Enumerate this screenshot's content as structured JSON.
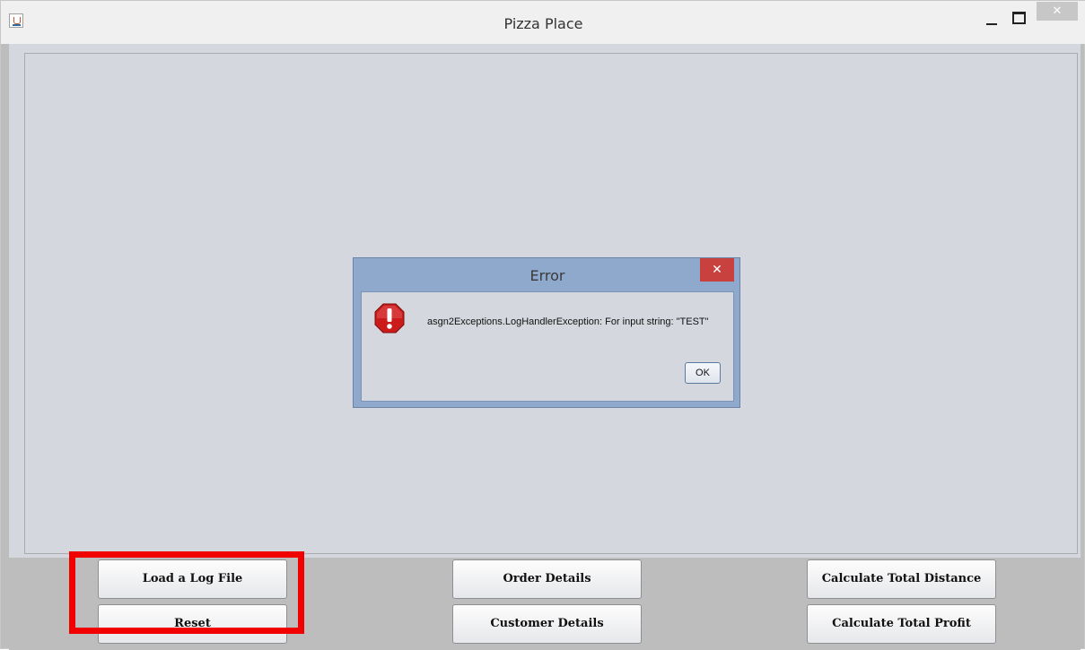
{
  "window": {
    "title": "Pizza Place",
    "minimize_icon": "minimize-icon",
    "maximize_icon": "maximize-icon",
    "close_glyph": "✕",
    "app_icon": "java-cup-icon"
  },
  "buttons": {
    "load_log_file": "Load a Log File",
    "reset": "Reset",
    "order_details": "Order Details",
    "customer_details": "Customer Details",
    "calculate_total_distance": "Calculate Total Distance",
    "calculate_total_profit": "Calculate Total Profit"
  },
  "dialog": {
    "title": "Error",
    "close_glyph": "✕",
    "icon": "error-icon",
    "message": "asgn2Exceptions.LogHandlerException: For input string: \"TEST\"",
    "ok_label": "OK"
  },
  "colors": {
    "highlight": "#f20000",
    "dialog_frame": "#8fa9cc",
    "dialog_close": "#c8413e",
    "panel_bg": "#d5d7de",
    "error_icon": "#cc1b1b"
  }
}
